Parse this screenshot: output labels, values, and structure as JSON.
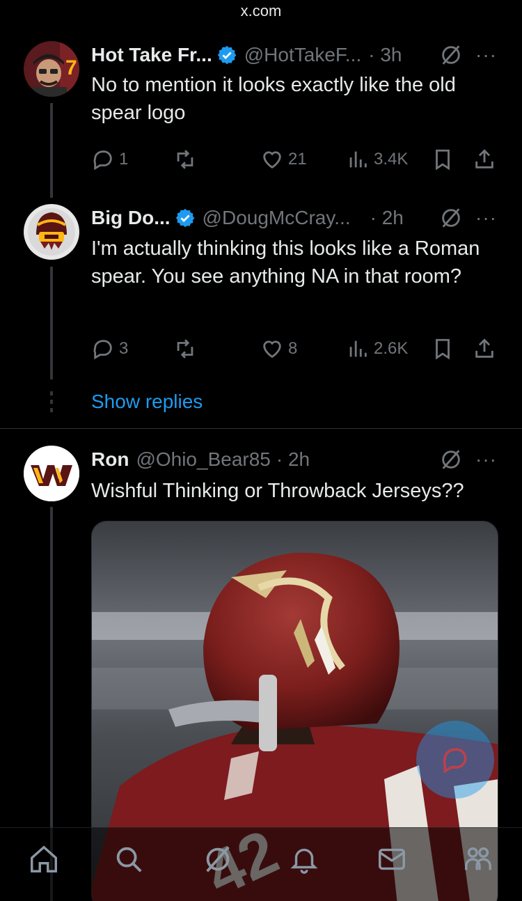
{
  "browser": {
    "url": "x.com"
  },
  "posts": [
    {
      "name": "Hot Take Fr...",
      "handle": "@HotTakeF...",
      "time": "· 3h",
      "more": "···",
      "text": "No to mention it looks exactly like the old spear logo",
      "replies": "1",
      "reposts": "",
      "likes": "21",
      "views": "3.4K",
      "verified": true
    },
    {
      "name": "Big Do...",
      "handle": "@DougMcCray...",
      "time": "· 2h",
      "more": "···",
      "text": "I'm actually thinking this looks like a Roman spear. You see anything NA in that room?",
      "replies": "3",
      "reposts": "",
      "likes": "8",
      "views": "2.6K",
      "verified": true
    },
    {
      "name": "Ron",
      "handle": "@Ohio_Bear85",
      "time": "· 2h",
      "more": "···",
      "text": "Wishful Thinking or Throwback Jerseys??",
      "verified": false
    }
  ],
  "thread": {
    "show_replies": "Show replies"
  },
  "media": {
    "jersey_number": "42"
  },
  "colors": {
    "accent": "#1d9bf0",
    "muted": "#71767b",
    "text": "#e7e9ea",
    "background": "#000000"
  },
  "tabbar": {
    "icons": [
      "home-icon",
      "search-icon",
      "grok-icon",
      "notifications-icon",
      "messages-icon",
      "communities-icon"
    ]
  }
}
